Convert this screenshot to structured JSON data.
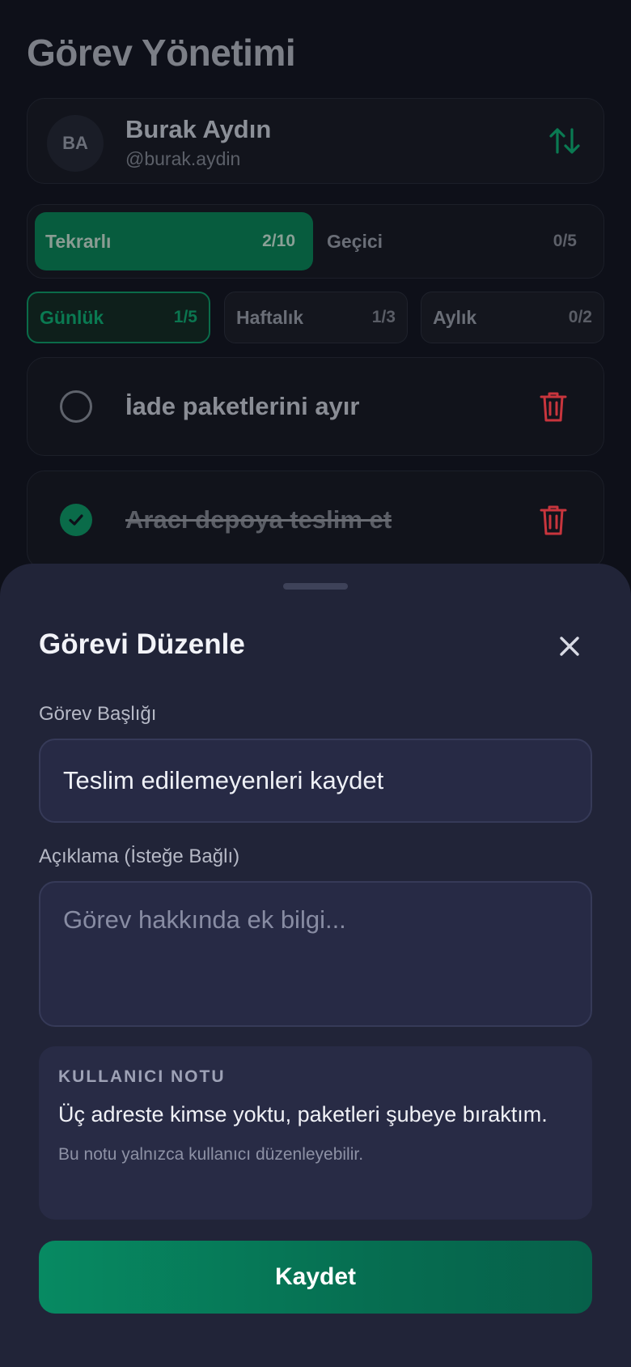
{
  "header": {
    "title": "Görev Yönetimi"
  },
  "profile": {
    "initials": "BA",
    "name": "Burak Aydın",
    "handle": "@burak.aydin",
    "sort_icon": "swap-vertical-icon"
  },
  "type_tabs": [
    {
      "label": "Tekrarlı",
      "count": "2/10",
      "active": true
    },
    {
      "label": "Geçici",
      "count": "0/5",
      "active": false
    }
  ],
  "period_tabs": [
    {
      "label": "Günlük",
      "count": "1/5",
      "active": true
    },
    {
      "label": "Haftalık",
      "count": "1/3",
      "active": false
    },
    {
      "label": "Aylık",
      "count": "0/2",
      "active": false
    }
  ],
  "tasks": [
    {
      "title": "İade paketlerini ayır",
      "completed": false
    },
    {
      "title": "Aracı depoya teslim et",
      "completed": true
    }
  ],
  "sheet": {
    "title": "Görevi Düzenle",
    "title_label": "Görev Başlığı",
    "title_value": "Teslim edilemeyenleri kaydet",
    "description_label": "Açıklama (İsteğe Bağlı)",
    "description_placeholder": "Görev hakkında ek bilgi...",
    "note_heading": "KULLANICI NOTU",
    "note_text": "Üç adreste kimse yoktu, paketleri şubeye bıraktım.",
    "note_hint": "Bu notu yalnızca kullanıcı düzenleyebilir.",
    "save_label": "Kaydet"
  },
  "colors": {
    "accent": "#078a62",
    "danger": "#c8353d",
    "sheet_bg": "#212438",
    "page_bg": "#0e1019"
  }
}
